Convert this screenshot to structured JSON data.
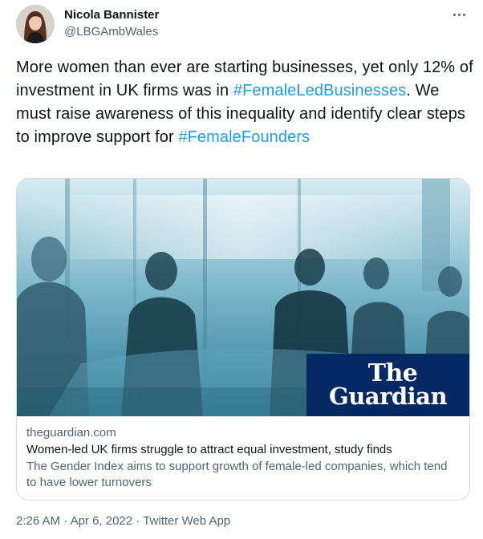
{
  "author": {
    "name": "Nicola Bannister",
    "handle": "@LBGAmbWales",
    "avatar_icon": "profile-photo"
  },
  "more_icon": "more-horizontal-icon",
  "tweet": {
    "text_1": "More women than ever are starting businesses, yet only 12% of investment in UK firms was in ",
    "hashtag_1": "#FemaleLedBusinesses",
    "text_2": ". We must raise awareness of this inequality and identify clear steps to improve support for ",
    "hashtag_2": "#FemaleFounders"
  },
  "card": {
    "logo_line1": "The",
    "logo_line2": "Guardian",
    "domain": "theguardian.com",
    "title": "Women-led UK firms struggle to attract equal investment, study finds",
    "description": "The Gender Index aims to support growth of female-led companies, which tend to have lower turnovers"
  },
  "footer": {
    "time": "2:26 AM",
    "separator": " · ",
    "date": "Apr 6, 2022",
    "source": "Twitter Web App"
  },
  "colors": {
    "accent": "#1d9bf0",
    "guardian_blue": "#052962",
    "secondary_text": "#536471"
  }
}
